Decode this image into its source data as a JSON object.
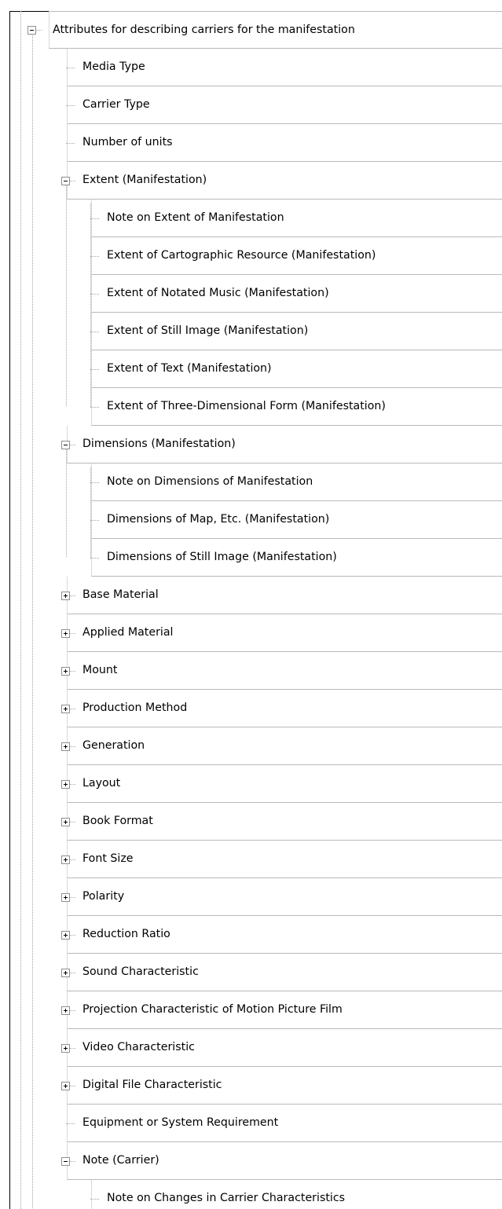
{
  "tree": {
    "root": {
      "label": "Attributes for describing carriers for the manifestation",
      "state": "collapse-icon"
    },
    "media_type": "Media Type",
    "carrier_type": "Carrier Type",
    "number_of_units": "Number of units",
    "extent": {
      "label": "Extent (Manifestation)",
      "state": "collapse-icon",
      "children": [
        "Note on Extent of Manifestation",
        "Extent of Cartographic Resource (Manifestation)",
        "Extent of Notated Music (Manifestation)",
        "Extent of Still Image (Manifestation)",
        "Extent of Text (Manifestation)",
        "Extent of Three-Dimensional Form (Manifestation)"
      ]
    },
    "dimensions": {
      "label": "Dimensions (Manifestation)",
      "state": "collapse-icon",
      "children": [
        "Note on Dimensions of Manifestation",
        "Dimensions of Map, Etc. (Manifestation)",
        "Dimensions of Still Image (Manifestation)"
      ]
    },
    "collapsed_items": [
      "Base Material",
      "Applied Material",
      "Mount",
      "Production Method",
      "Generation",
      "Layout",
      "Book Format",
      "Font Size",
      "Polarity",
      "Reduction Ratio",
      "Sound Characteristic",
      "Projection Characteristic of Motion Picture Film",
      "Video Characteristic",
      "Digital File Characteristic"
    ],
    "collapsed_state": "expand-icon",
    "equipment": "Equipment or System Requirement",
    "note_carrier": {
      "label": "Note (Carrier)",
      "state": "collapse-icon",
      "children": [
        "Note on Changes in Carrier Characteristics"
      ]
    }
  }
}
